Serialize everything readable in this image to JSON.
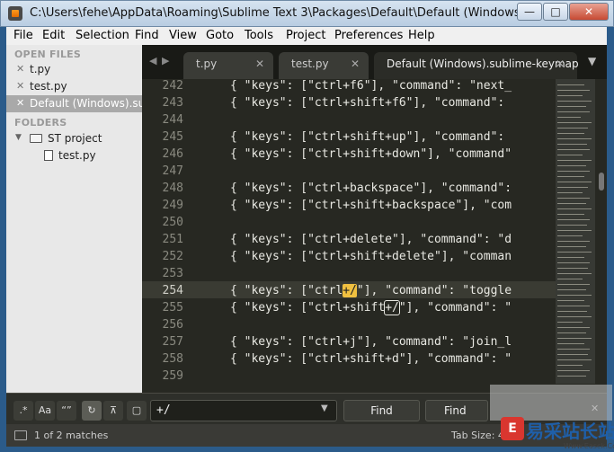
{
  "window": {
    "title": "C:\\Users\\fehe\\AppData\\Roaming\\Sublime Text 3\\Packages\\Default\\Default (Windows).subli",
    "min_glyph": "—",
    "max_glyph": "□",
    "close_glyph": "✕"
  },
  "menu": [
    "File",
    "Edit",
    "Selection",
    "Find",
    "View",
    "Goto",
    "Tools",
    "Project",
    "Preferences",
    "Help"
  ],
  "sidebar": {
    "open_files_header": "OPEN FILES",
    "open_files": [
      "t.py",
      "test.py",
      "Default (Windows).sublime-keymap"
    ],
    "folders_header": "FOLDERS",
    "folder_name": "ST project",
    "folder_file": "test.py",
    "close_glyph": "✕",
    "folder_arrow": "▼",
    "folder_icon": "folder-icon",
    "file_icon": "file-icon"
  },
  "tabs": {
    "prev_glyph": "◀",
    "next_glyph": "▶",
    "menu_glyph": "▼",
    "close_glyph": "✕",
    "items": [
      "t.py",
      "test.py",
      "Default (Windows).sublime-keymap"
    ]
  },
  "editor": {
    "line_numbers": [
      "242",
      "243",
      "244",
      "245",
      "246",
      "247",
      "248",
      "249",
      "250",
      "251",
      "252",
      "253",
      "254",
      "255",
      "256",
      "257",
      "258",
      "259"
    ],
    "lines": [
      "{ \"keys\": [\"ctrl+f6\"], \"command\": \"next_",
      "{ \"keys\": [\"ctrl+shift+f6\"], \"command\": ",
      "",
      "{ \"keys\": [\"ctrl+shift+up\"], \"command\": ",
      "{ \"keys\": [\"ctrl+shift+down\"], \"command\"",
      "",
      "{ \"keys\": [\"ctrl+backspace\"], \"command\": ",
      "{ \"keys\": [\"ctrl+shift+backspace\"], \"com",
      "",
      "{ \"keys\": [\"ctrl+delete\"], \"command\": \"d",
      "{ \"keys\": [\"ctrl+shift+delete\"], \"comman",
      "",
      "",
      "",
      "",
      "{ \"keys\": [\"ctrl+j\"], \"command\": \"join_l",
      "{ \"keys\": [\"ctrl+shift+d\"], \"command\": \"",
      ""
    ],
    "line254": {
      "pre": "{ \"keys\": [\"ctrl",
      "match": "+/",
      "post": "\"], \"command\": \"toggle"
    },
    "line255": {
      "pre": "{ \"keys\": [\"ctrl+shift",
      "match": "+/",
      "post": "\"], \"command\": \""
    }
  },
  "find": {
    "opt_regex": ".*",
    "opt_case": "Aa",
    "opt_word": "“”",
    "opt_wrap": "↻",
    "opt_selection": "⊼",
    "opt_highlight": "▢",
    "query": "+/",
    "dropdown_glyph": "▼",
    "find_label": "Find",
    "find_prev_label": "Find",
    "close_glyph": "✕"
  },
  "status": {
    "matches": "1 of 2 matches",
    "tab_size": "Tab Size: 4"
  },
  "watermark": {
    "logo_char": "E",
    "text": "易采站长站",
    "url": "Www.Easck.Com"
  }
}
